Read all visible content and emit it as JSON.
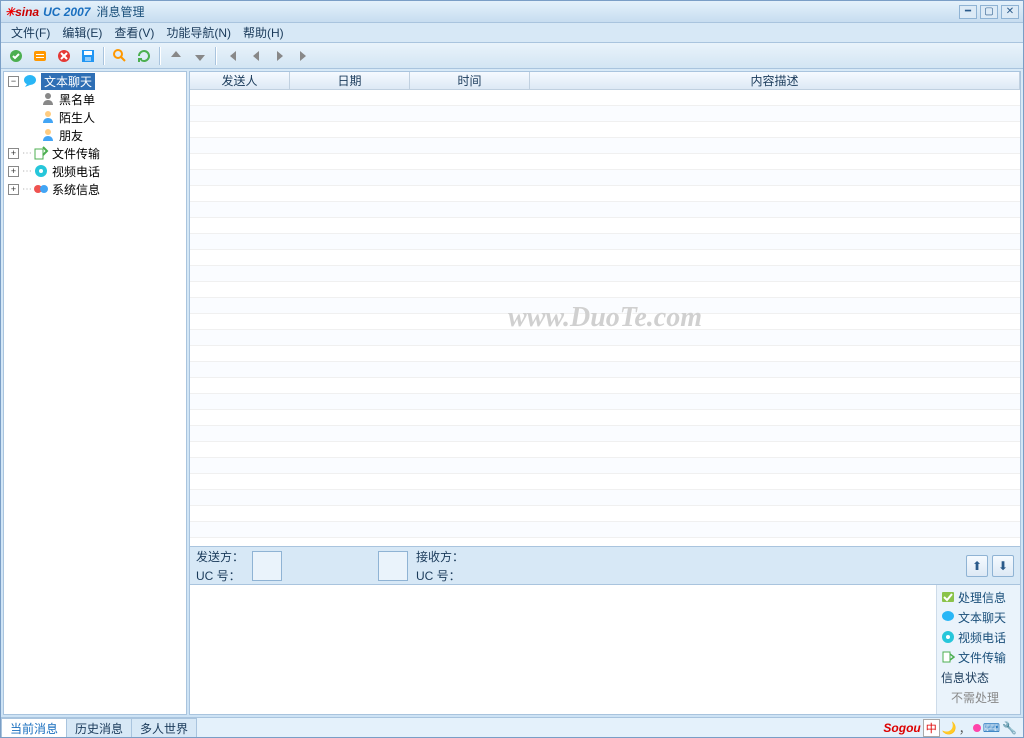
{
  "title": {
    "brand1": "sina",
    "brand2": "UC 2007",
    "text": "消息管理"
  },
  "menu": {
    "file": "文件(F)",
    "edit": "编辑(E)",
    "view": "查看(V)",
    "nav": "功能导航(N)",
    "help": "帮助(H)"
  },
  "tree": {
    "root_text_chat": "文本聊天",
    "blacklist": "黑名单",
    "stranger": "陌生人",
    "friend": "朋友",
    "file_transfer": "文件传输",
    "video_call": "视频电话",
    "system_info": "系统信息"
  },
  "columns": {
    "sender": "发送人",
    "date": "日期",
    "time": "时间",
    "desc": "内容描述"
  },
  "info": {
    "sender_label": "发送方：",
    "uc_label_left": "UC  号：",
    "receiver_label": "接收方：",
    "uc_label_right": "UC  号："
  },
  "sidemenu": {
    "process": "处理信息",
    "text_chat": "文本聊天",
    "video_call": "视频电话",
    "file_transfer": "文件传输",
    "status_header": "信息状态",
    "no_need": "不需处理"
  },
  "tabs": {
    "current": "当前消息",
    "history": "历史消息",
    "world": "多人世界"
  },
  "watermark": "www.DuoTe.com",
  "ime": {
    "brand": "Sogou",
    "lang": "中"
  }
}
